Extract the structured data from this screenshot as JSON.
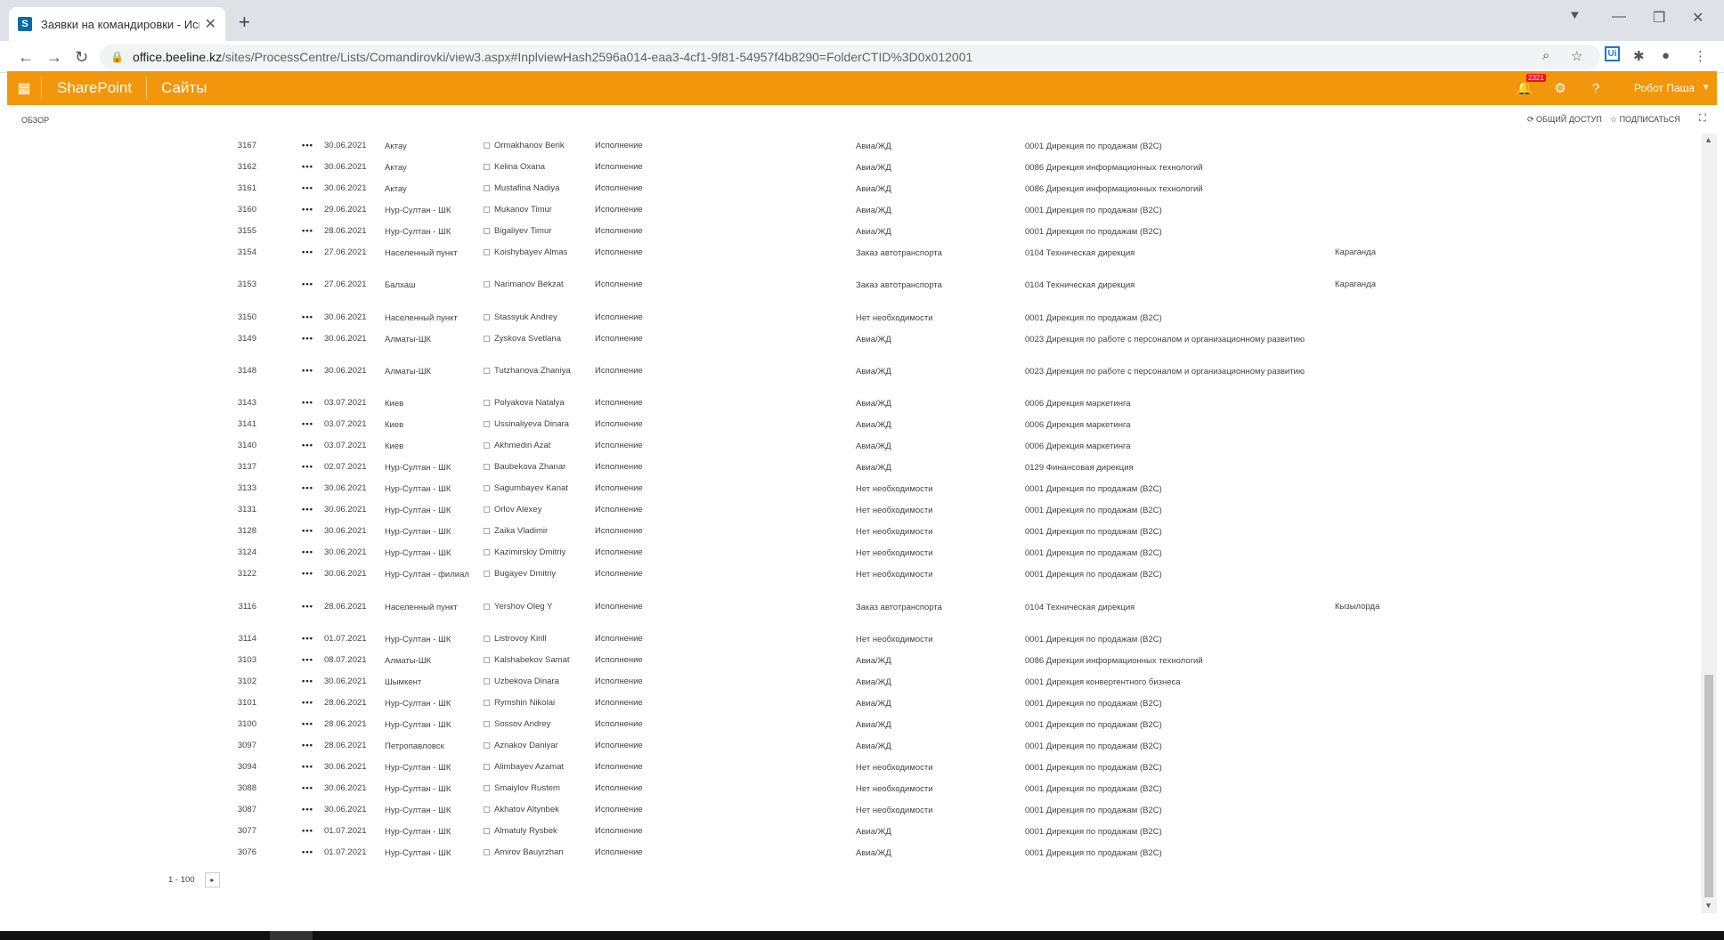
{
  "browser": {
    "tab_title": "Заявки на командировки - Исп",
    "tab_favicon": "S",
    "new_tab": "+",
    "url_host": "office.beeline.kz",
    "url_path": "/sites/ProcessCentre/Lists/Comandirovki/view3.aspx#InplviewHash2596a014-eaa3-4cf1-9f81-54957f4b8290=FolderCTID%3D0x012001",
    "ext_label": "Ui"
  },
  "sharepoint": {
    "brand": "SharePoint",
    "sites": "Сайты",
    "notification_count": "2321",
    "help": "?",
    "user": "Робот Паша",
    "accent": "#f2960c"
  },
  "ribbon": {
    "browse": "ОБЗОР",
    "share": "ОБЩИЙ ДОСТУП",
    "follow": "ПОДПИСАТЬСЯ"
  },
  "rows": [
    {
      "id": "3167",
      "date": "30.06.2021",
      "city": "Актау",
      "name": "Ormakhanov Berik",
      "status": "Исполнение",
      "transport": "Авиа/ЖД",
      "dept": "0001 Дирекция по продажам (B2C)",
      "city2": ""
    },
    {
      "id": "3162",
      "date": "30.06.2021",
      "city": "Актау",
      "name": "Kelina Oxana",
      "status": "Исполнение",
      "transport": "Авиа/ЖД",
      "dept": "0086 Дирекция информационных технологий",
      "city2": ""
    },
    {
      "id": "3161",
      "date": "30.06.2021",
      "city": "Актау",
      "name": "Mustafina Nadiya",
      "status": "Исполнение",
      "transport": "Авиа/ЖД",
      "dept": "0086 Дирекция информационных технологий",
      "city2": ""
    },
    {
      "id": "3160",
      "date": "29.06.2021",
      "city": "Нур-Султан - ШК",
      "name": "Mukanov Timur",
      "status": "Исполнение",
      "transport": "Авиа/ЖД",
      "dept": "0001 Дирекция по продажам (B2C)",
      "city2": ""
    },
    {
      "id": "3155",
      "date": "28.06.2021",
      "city": "Нур-Султан - ШК",
      "name": "Bigaliyev Timur",
      "status": "Исполнение",
      "transport": "Авиа/ЖД",
      "dept": "0001 Дирекция по продажам (B2C)",
      "city2": ""
    },
    {
      "id": "3154",
      "date": "27.06.2021",
      "city": "Населенный пункт",
      "name": "Koishybayev Almas",
      "status": "Исполнение",
      "transport": "Заказ автотранспорта",
      "dept": "0104 Техническая дирекция",
      "city2": "Караганда"
    },
    {
      "id": "3153",
      "date": "27.06.2021",
      "city": "Балхаш",
      "name": "Narimanov Bekzat",
      "status": "Исполнение",
      "transport": "Заказ автотранспорта",
      "dept": "0104 Техническая дирекция",
      "city2": "Караганда"
    },
    {
      "id": "3150",
      "date": "30.06.2021",
      "city": "Населенный пункт",
      "name": "Stassyuk Andrey",
      "status": "Исполнение",
      "transport": "Нет необходимости",
      "dept": "0001 Дирекция по продажам (B2C)",
      "city2": ""
    },
    {
      "id": "3149",
      "date": "30.06.2021",
      "city": "Алматы-ШК",
      "name": "Zyskova Svetlana",
      "status": "Исполнение",
      "transport": "Авиа/ЖД",
      "dept": "0023 Дирекция по работе с персоналом и организационному развитию",
      "city2": ""
    },
    {
      "id": "3148",
      "date": "30.06.2021",
      "city": "Алматы-ШК",
      "name": "Tutzhanova Zhaniya",
      "status": "Исполнение",
      "transport": "Авиа/ЖД",
      "dept": "0023 Дирекция по работе с персоналом и организационному развитию",
      "city2": ""
    },
    {
      "id": "3143",
      "date": "03.07.2021",
      "city": "Киев",
      "name": "Polyakova Natalya",
      "status": "Исполнение",
      "transport": "Авиа/ЖД",
      "dept": "0006 Дирекция маркетинга",
      "city2": ""
    },
    {
      "id": "3141",
      "date": "03.07.2021",
      "city": "Киев",
      "name": "Ussinaliyeva Dinara",
      "status": "Исполнение",
      "transport": "Авиа/ЖД",
      "dept": "0006 Дирекция маркетинга",
      "city2": ""
    },
    {
      "id": "3140",
      "date": "03.07.2021",
      "city": "Киев",
      "name": "Akhmedin Azat",
      "status": "Исполнение",
      "transport": "Авиа/ЖД",
      "dept": "0006 Дирекция маркетинга",
      "city2": ""
    },
    {
      "id": "3137",
      "date": "02.07.2021",
      "city": "Нур-Султан - ШК",
      "name": "Baubekova Zhanar",
      "status": "Исполнение",
      "transport": "Авиа/ЖД",
      "dept": "0129 Финансовая дирекция",
      "city2": ""
    },
    {
      "id": "3133",
      "date": "30.06.2021",
      "city": "Нур-Султан - ШК",
      "name": "Sagumbayev Kanat",
      "status": "Исполнение",
      "transport": "Нет необходимости",
      "dept": "0001 Дирекция по продажам (B2C)",
      "city2": ""
    },
    {
      "id": "3131",
      "date": "30.06.2021",
      "city": "Нур-Султан - ШК",
      "name": "Orlov Alexey",
      "status": "Исполнение",
      "transport": "Нет необходимости",
      "dept": "0001 Дирекция по продажам (B2C)",
      "city2": ""
    },
    {
      "id": "3128",
      "date": "30.06.2021",
      "city": "Нур-Султан - ШК",
      "name": "Zaika Vladimir",
      "status": "Исполнение",
      "transport": "Нет необходимости",
      "dept": "0001 Дирекция по продажам (B2C)",
      "city2": ""
    },
    {
      "id": "3124",
      "date": "30.06.2021",
      "city": "Нур-Султан - ШК",
      "name": "Kazimirskiy Dmitriy",
      "status": "Исполнение",
      "transport": "Нет необходимости",
      "dept": "0001 Дирекция по продажам (B2C)",
      "city2": ""
    },
    {
      "id": "3122",
      "date": "30.06.2021",
      "city": "Нур-Султан - филиал",
      "name": "Bugayev Dmitriy",
      "status": "Исполнение",
      "transport": "Нет необходимости",
      "dept": "0001 Дирекция по продажам (B2C)",
      "city2": ""
    },
    {
      "id": "3116",
      "date": "28.06.2021",
      "city": "Населенный пункт",
      "name": "Yershov Oleg Y",
      "status": "Исполнение",
      "transport": "Заказ автотранспорта",
      "dept": "0104 Техническая дирекция",
      "city2": "Кызылорда"
    },
    {
      "id": "3114",
      "date": "01.07.2021",
      "city": "Нур-Султан - ШК",
      "name": "Listrovoy Kirill",
      "status": "Исполнение",
      "transport": "Нет необходимости",
      "dept": "0001 Дирекция по продажам (B2C)",
      "city2": ""
    },
    {
      "id": "3103",
      "date": "08.07.2021",
      "city": "Алматы-ШК",
      "name": "Kalshabekov Samat",
      "status": "Исполнение",
      "transport": "Авиа/ЖД",
      "dept": "0086 Дирекция информационных технологий",
      "city2": ""
    },
    {
      "id": "3102",
      "date": "30.06.2021",
      "city": "Шымкент",
      "name": "Uzbekova Dinara",
      "status": "Исполнение",
      "transport": "Авиа/ЖД",
      "dept": "0001 Дирекция конвергентного бизнеса",
      "city2": ""
    },
    {
      "id": "3101",
      "date": "28.06.2021",
      "city": "Нур-Султан - ШК",
      "name": "Rymshin Nikolai",
      "status": "Исполнение",
      "transport": "Авиа/ЖД",
      "dept": "0001 Дирекция по продажам (B2C)",
      "city2": ""
    },
    {
      "id": "3100",
      "date": "28.06.2021",
      "city": "Нур-Султан - ШК",
      "name": "Sossov Andrey",
      "status": "Исполнение",
      "transport": "Авиа/ЖД",
      "dept": "0001 Дирекция по продажам (B2C)",
      "city2": ""
    },
    {
      "id": "3097",
      "date": "28.06.2021",
      "city": "Петропавловск",
      "name": "Aznakov Daniyar",
      "status": "Исполнение",
      "transport": "Авиа/ЖД",
      "dept": "0001 Дирекция по продажам (B2C)",
      "city2": ""
    },
    {
      "id": "3094",
      "date": "30.06.2021",
      "city": "Нур-Султан - ШК",
      "name": "Alimbayev Azamat",
      "status": "Исполнение",
      "transport": "Нет необходимости",
      "dept": "0001 Дирекция по продажам (B2C)",
      "city2": ""
    },
    {
      "id": "3088",
      "date": "30.06.2021",
      "city": "Нур-Султан - ШК",
      "name": "Smaiylov Rustem",
      "status": "Исполнение",
      "transport": "Нет необходимости",
      "dept": "0001 Дирекция по продажам (B2C)",
      "city2": ""
    },
    {
      "id": "3087",
      "date": "30.06.2021",
      "city": "Нур-Султан - ШК",
      "name": "Akhatov Altynbek",
      "status": "Исполнение",
      "transport": "Нет необходимости",
      "dept": "0001 Дирекция по продажам (B2C)",
      "city2": ""
    },
    {
      "id": "3077",
      "date": "01.07.2021",
      "city": "Нур-Султан - ШК",
      "name": "Almatuly Rysbek",
      "status": "Исполнение",
      "transport": "Авиа/ЖД",
      "dept": "0001 Дирекция по продажам (B2C)",
      "city2": ""
    },
    {
      "id": "3076",
      "date": "01.07.2021",
      "city": "Нур-Султан - ШК",
      "name": "Amirov Bauyrzhan",
      "status": "Исполнение",
      "transport": "Авиа/ЖД",
      "dept": "0001 Дирекция по продажам (B2C)",
      "city2": ""
    }
  ],
  "pager": {
    "range": "1 - 100",
    "next": "▸"
  }
}
